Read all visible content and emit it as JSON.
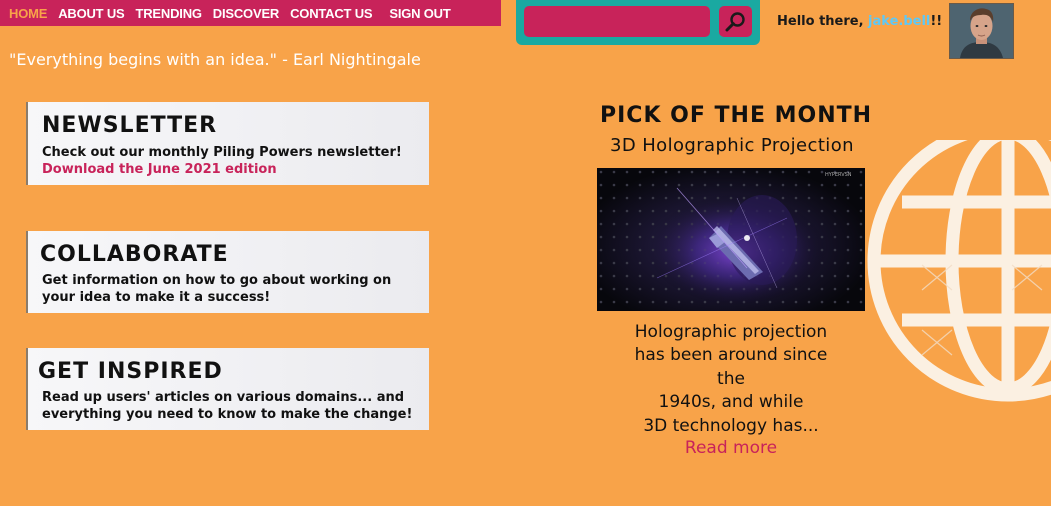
{
  "nav": {
    "items": [
      {
        "label": "HOME"
      },
      {
        "label": "ABOUT US"
      },
      {
        "label": "TRENDING"
      },
      {
        "label": "DISCOVER"
      },
      {
        "label": "CONTACT US"
      },
      {
        "label": "SIGN OUT"
      }
    ],
    "active_index": 0
  },
  "search": {
    "value": "",
    "placeholder": "",
    "icon": "search-icon"
  },
  "greeting": {
    "prefix": "Hello there, ",
    "username": "jake.bell",
    "suffix": "!!"
  },
  "avatar": {
    "icon": "avatar"
  },
  "quote": "\"Everything begins with an idea.\" - Earl Nightingale",
  "cards": [
    {
      "title": "NEWSLETTER",
      "text": "Check out our monthly Piling Powers newsletter!",
      "link": "Download the June 2021 edition"
    },
    {
      "title": "COLLABORATE",
      "text": "Get information on how to go about working on your idea to make it a success!"
    },
    {
      "title": "GET INSPIRED",
      "text": "Read up users' articles on various domains... and everything you need to know to make the change!"
    }
  ],
  "pick": {
    "title": "PICK OF THE MONTH",
    "subtitle": "3D Holographic Projection",
    "image_watermark": "HYPERVSN",
    "desc_lines": [
      "Holographic projection",
      "has been around since",
      "the",
      "1940s, and while",
      "3D technology has..."
    ],
    "read_more": "Read more"
  },
  "colors": {
    "background": "#F8A349",
    "accent": "#C8235A",
    "search_frame": "#1AA9A1",
    "username": "#5FC8F5"
  }
}
